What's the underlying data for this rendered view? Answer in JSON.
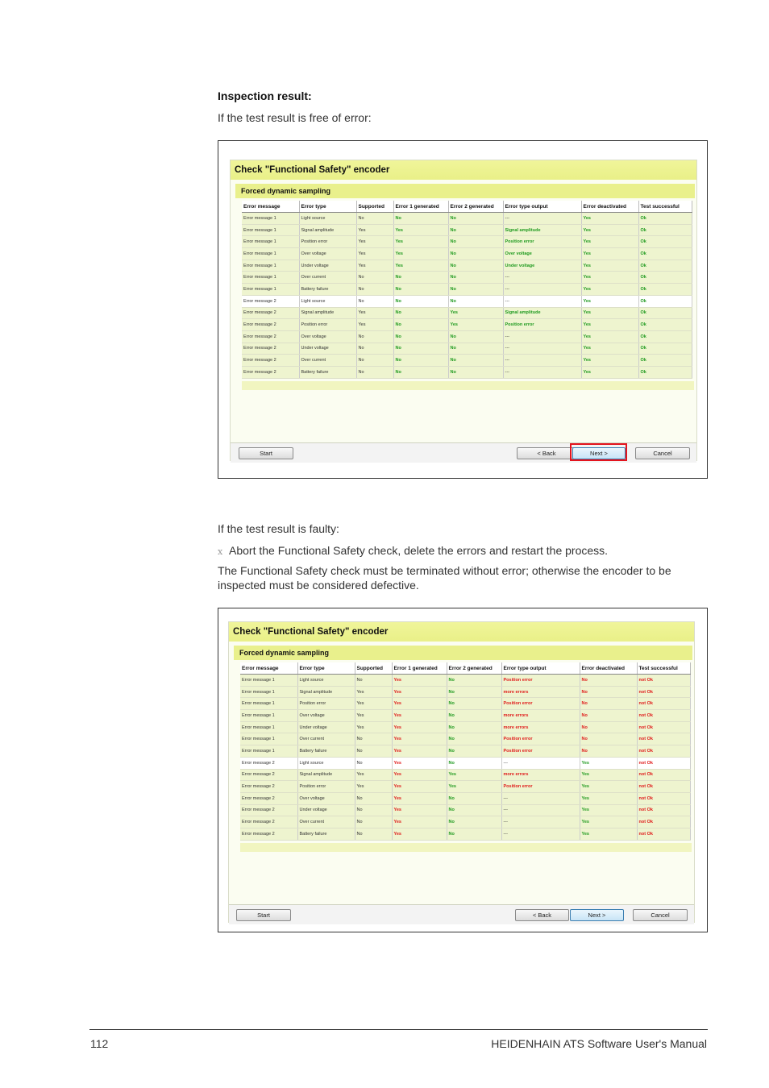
{
  "heading": "Inspection result:",
  "intro_ok": "If the test result is free of error:",
  "intro_faulty": "If the test result is faulty:",
  "bullet_marker": "x",
  "step": "Abort the Functional Safety check, delete the errors and restart the process.",
  "note": "The Functional Safety check must be terminated without error; otherwise the encoder to be inspected must be considered defective.",
  "footer": {
    "page_number": "112",
    "manual_title": "HEIDENHAIN ATS Software User's Manual"
  },
  "colors": {
    "title_bar": "#f0f59a",
    "section_bar": "#e9f08c",
    "ok_green": "#1f9a1f",
    "error_red": "#e01a1a",
    "highlight_border": "#e3141e"
  },
  "dialog": {
    "title": "Check \"Functional Safety\" encoder",
    "section": "Forced dynamic sampling",
    "columns": [
      "Error message",
      "Error type",
      "Supported",
      "Error 1 generated",
      "Error 2 generated",
      "Error type output",
      "Error deactivated",
      "Test successful"
    ],
    "buttons": {
      "start": "Start",
      "back": "< Back",
      "next": "Next >",
      "cancel": "Cancel"
    }
  },
  "screenshot_ok": {
    "rows": [
      [
        "Error message 1",
        "Light source",
        "No",
        "No",
        "No",
        "---",
        "Yes",
        "Ok"
      ],
      [
        "Error message 1",
        "Signal amplitude",
        "Yes",
        "Yes",
        "No",
        "Signal amplitude",
        "Yes",
        "Ok"
      ],
      [
        "Error message 1",
        "Position error",
        "Yes",
        "Yes",
        "No",
        "Position error",
        "Yes",
        "Ok"
      ],
      [
        "Error message 1",
        "Over voltage",
        "Yes",
        "Yes",
        "No",
        "Over voltage",
        "Yes",
        "Ok"
      ],
      [
        "Error message 1",
        "Under voltage",
        "Yes",
        "Yes",
        "No",
        "Under voltage",
        "Yes",
        "Ok"
      ],
      [
        "Error message 1",
        "Over current",
        "No",
        "No",
        "No",
        "---",
        "Yes",
        "Ok"
      ],
      [
        "Error message 1",
        "Battery failure",
        "No",
        "No",
        "No",
        "---",
        "Yes",
        "Ok"
      ],
      [
        "Error message 2",
        "Light source",
        "No",
        "No",
        "No",
        "---",
        "Yes",
        "Ok"
      ],
      [
        "Error message 2",
        "Signal amplitude",
        "Yes",
        "No",
        "Yes",
        "Signal amplitude",
        "Yes",
        "Ok"
      ],
      [
        "Error message 2",
        "Position error",
        "Yes",
        "No",
        "Yes",
        "Position error",
        "Yes",
        "Ok"
      ],
      [
        "Error message 2",
        "Over voltage",
        "No",
        "No",
        "No",
        "---",
        "Yes",
        "Ok"
      ],
      [
        "Error message 2",
        "Under voltage",
        "No",
        "No",
        "No",
        "---",
        "Yes",
        "Ok"
      ],
      [
        "Error message 2",
        "Over current",
        "No",
        "No",
        "No",
        "---",
        "Yes",
        "Ok"
      ],
      [
        "Error message 2",
        "Battery failure",
        "No",
        "No",
        "No",
        "---",
        "Yes",
        "Ok"
      ]
    ]
  },
  "screenshot_faulty": {
    "rows": [
      [
        "Error message 1",
        "Light source",
        "No",
        "Yes",
        "No",
        "Position error",
        "No",
        "not Ok"
      ],
      [
        "Error message 1",
        "Signal amplitude",
        "Yes",
        "Yes",
        "No",
        "more errors",
        "No",
        "not Ok"
      ],
      [
        "Error message 1",
        "Position error",
        "Yes",
        "Yes",
        "No",
        "Position error",
        "No",
        "not Ok"
      ],
      [
        "Error message 1",
        "Over voltage",
        "Yes",
        "Yes",
        "No",
        "more errors",
        "No",
        "not Ok"
      ],
      [
        "Error message 1",
        "Under voltage",
        "Yes",
        "Yes",
        "No",
        "more errors",
        "No",
        "not Ok"
      ],
      [
        "Error message 1",
        "Over current",
        "No",
        "Yes",
        "No",
        "Position error",
        "No",
        "not Ok"
      ],
      [
        "Error message 1",
        "Battery failure",
        "No",
        "Yes",
        "No",
        "Position error",
        "No",
        "not Ok"
      ],
      [
        "Error message 2",
        "Light source",
        "No",
        "Yes",
        "No",
        "---",
        "Yes",
        "not Ok"
      ],
      [
        "Error message 2",
        "Signal amplitude",
        "Yes",
        "Yes",
        "Yes",
        "more errors",
        "Yes",
        "not Ok"
      ],
      [
        "Error message 2",
        "Position error",
        "Yes",
        "Yes",
        "Yes",
        "Position error",
        "Yes",
        "not Ok"
      ],
      [
        "Error message 2",
        "Over voltage",
        "No",
        "Yes",
        "No",
        "---",
        "Yes",
        "not Ok"
      ],
      [
        "Error message 2",
        "Under voltage",
        "No",
        "Yes",
        "No",
        "---",
        "Yes",
        "not Ok"
      ],
      [
        "Error message 2",
        "Over current",
        "No",
        "Yes",
        "No",
        "---",
        "Yes",
        "not Ok"
      ],
      [
        "Error message 2",
        "Battery failure",
        "No",
        "Yes",
        "No",
        "---",
        "Yes",
        "not Ok"
      ]
    ]
  }
}
